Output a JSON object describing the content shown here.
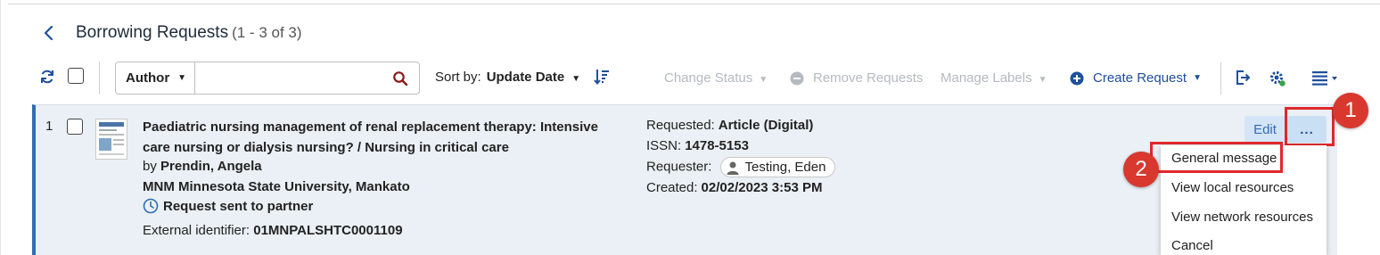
{
  "page": {
    "title": "Borrowing Requests",
    "count": "(1 - 3 of 3)"
  },
  "toolbar": {
    "search_field": "Author",
    "search_value": "",
    "sort_label": "Sort by:",
    "sort_value": "Update Date",
    "change_status": "Change Status",
    "remove_requests": "Remove Requests",
    "manage_labels": "Manage Labels",
    "create_request": "Create Request"
  },
  "request": {
    "index": "1",
    "title": "Paediatric nursing management of renal replacement therapy: Intensive care nursing or dialysis nursing? / Nursing in critical care",
    "by_label": "by",
    "author": "Prendin, Angela",
    "library": "MNM Minnesota State University, Mankato",
    "status": "Request sent to partner",
    "external_id_label": "External identifier:",
    "external_id": "01MNPALSHTC0001109",
    "requested_label": "Requested:",
    "requested": "Article (Digital)",
    "issn_label": "ISSN:",
    "issn": "1478-5153",
    "requester_label": "Requester:",
    "requester": "Testing, Eden",
    "created_label": "Created:",
    "created": "02/02/2023 3:53 PM",
    "edit_label": "Edit",
    "more_label": "..."
  },
  "menu": {
    "items": [
      "General message",
      "View local resources",
      "View network resources",
      "Cancel"
    ]
  },
  "annotations": {
    "badge1": "1",
    "badge2": "2"
  },
  "colors": {
    "accent": "#1f4f9c",
    "row_bg": "#eaf0f5",
    "highlight": "#e0282c",
    "badge": "#d8382e",
    "disabled": "#b5b9c0"
  }
}
